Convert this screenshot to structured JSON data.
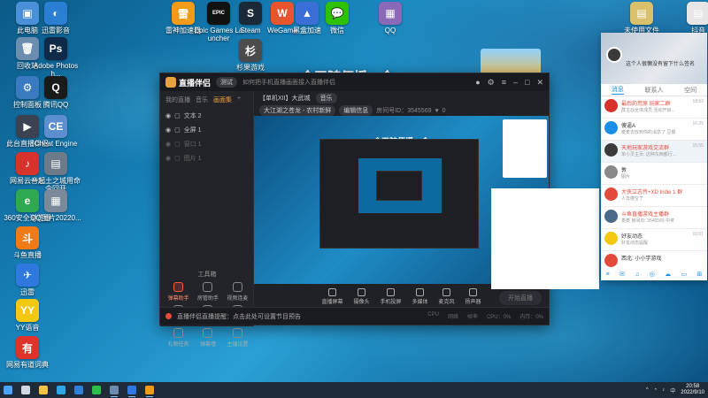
{
  "desktop": {
    "icons": [
      {
        "label": "此电脑",
        "color": "#4a90d9",
        "glyph": "▣"
      },
      {
        "label": "迅雷影音",
        "color": "#2a7fd4",
        "glyph": "◐"
      },
      {
        "label": "回收站",
        "color": "#6b8db0",
        "glyph": "🗑"
      },
      {
        "label": "Adobe Photosh...",
        "color": "#0e2a48",
        "glyph": "Ps"
      },
      {
        "label": "控制面板",
        "color": "#3a7ac0",
        "glyph": "⚙"
      },
      {
        "label": "腾讯QQ",
        "color": "#1a1a1a",
        "glyph": "Q"
      },
      {
        "label": "此台直播伴侣",
        "color": "#3b4252",
        "glyph": "▶"
      },
      {
        "label": "Cheat Engine",
        "color": "#5b8fd0",
        "glyph": "CE"
      },
      {
        "label": "网易云音乐",
        "color": "#d8322c",
        "glyph": "♪"
      },
      {
        "label": "一起土之城用命令回开",
        "color": "#6c7a8a",
        "glyph": "▤"
      },
      {
        "label": "360安全浏览器",
        "color": "#2fa84f",
        "glyph": "e"
      },
      {
        "label": "QQ图片20220...",
        "color": "#7a8a9a",
        "glyph": "▦"
      },
      {
        "label": "斗鱼直播",
        "color": "#f07b16",
        "glyph": "斗"
      },
      {
        "label": "迅雷",
        "color": "#2e78e0",
        "glyph": "✈"
      },
      {
        "label": "YY语音",
        "color": "#f2c811",
        "glyph": "YY"
      },
      {
        "label": "网易有道词典",
        "color": "#e0322a",
        "glyph": "有"
      },
      {
        "label": "雷神加速器",
        "color": "#f29b1a",
        "glyph": "雷"
      },
      {
        "label": "Epic Games Launcher",
        "color": "#111111",
        "glyph": "EPIC"
      },
      {
        "label": "Steam",
        "color": "#1b2838",
        "glyph": "S"
      },
      {
        "label": "WeGame",
        "color": "#e8542e",
        "glyph": "W"
      },
      {
        "label": "黑盒加速",
        "color": "#3a6fd8",
        "glyph": "▲"
      },
      {
        "label": "微信",
        "color": "#2dc100",
        "glyph": "💬"
      },
      {
        "label": "杉果游戏",
        "color": "#4c4c4c",
        "glyph": "杉"
      },
      {
        "label": "QQ",
        "color": "#8a6ab8",
        "glyph": "▦"
      },
      {
        "label": "未使用文件",
        "color": "#d8c16a",
        "glyph": "▤"
      },
      {
        "label": "抖音",
        "color": "#e6e6e6",
        "glyph": "▤"
      }
    ]
  },
  "banner": {
    "text": "今天随便播一会"
  },
  "app": {
    "logo": "直播伴侣",
    "version_chip": "测试",
    "notice": "如何把手机直播画面接入直播伴侣",
    "left_tabs": [
      "我的直播",
      "音乐",
      "画面集"
    ],
    "scenes": [
      {
        "label": "文本 2",
        "dim": false
      },
      {
        "label": "全屏 1",
        "dim": false
      },
      {
        "label": "窗口 1",
        "dim": true
      },
      {
        "label": "图片 1",
        "dim": true
      }
    ],
    "tools_title": "工具箱",
    "tools": [
      {
        "label": "弹幕助手",
        "hot": true
      },
      {
        "label": "房管助手",
        "hot": false
      },
      {
        "label": "视频连麦",
        "hot": false
      },
      {
        "label": "全网打PK",
        "hot": false
      },
      {
        "label": "斗鱼Buff",
        "hot": false
      },
      {
        "label": "投屏器",
        "hot": false
      },
      {
        "label": "礼物任务",
        "hot": false
      },
      {
        "label": "弹幕墙",
        "hot": false
      },
      {
        "label": "主播设置",
        "hot": false
      }
    ],
    "room_tag": "【单机XII】大武城",
    "room_chip": "音乐",
    "category": "大江湖之苍龙 - 农村新鲜",
    "edit_btn": "编辑信息",
    "room_id": "房间号ID：3545569",
    "fans": "0",
    "bottom_buttons": [
      "直播屏幕",
      "摄像头",
      "手机投屏",
      "多媒体",
      "麦克风",
      "扬声器"
    ],
    "start_button": "开始直播",
    "status_hint": "直播伴侣直播提醒：点击此处可设置节目预告",
    "status_right": [
      "CPU",
      "网络",
      "帧率",
      "CPU：0%",
      "内存：0%"
    ]
  },
  "chat": {
    "status_text": "这个人很懒没有留下什么签名",
    "tabs": [
      "消息",
      "联系人",
      "空间"
    ],
    "active_tab": 0,
    "items": [
      {
        "name": "最后的荒原 玩家二群",
        "msg": "群主@全体成员 活动开启...",
        "time": "18:52",
        "name_red": true,
        "color": "#d8322c"
      },
      {
        "name": "傻逼A",
        "msg": "麦麦去收到你的消息了 豆瓣",
        "time": "16:25",
        "name_red": false,
        "color": "#1a8fe8"
      },
      {
        "name": "天地玩家游戏交流群",
        "msg": "单小灵主页: 这种东西都行...",
        "time": "15:55",
        "name_red": true,
        "color": "#3a3a3a"
      },
      {
        "name": "敦",
        "msg": "图片",
        "time": "",
        "name_red": false,
        "color": "#888888"
      },
      {
        "name": "大侠立志传+XD Indie 1 群",
        "msg": "人去楼空了",
        "time": "",
        "name_red": true,
        "color": "#e24a3c"
      },
      {
        "name": "斗鱼直播游戏主播群",
        "msg": "麦麦 房间ID: 3545569 中奖",
        "time": "",
        "name_red": true,
        "color": "#4a6a8a"
      },
      {
        "name": "好友动态",
        "msg": "好友动态提醒",
        "time": "16:01",
        "name_red": false,
        "color": "#f2c811"
      },
      {
        "name": "西北: 小小学游戏",
        "msg": "",
        "time": "",
        "name_red": false,
        "color": "#e24a3c"
      }
    ],
    "footer_icons": [
      "≡",
      "✉",
      "♫",
      "◎",
      "☁",
      "▭",
      "⊞"
    ]
  },
  "taskbar": {
    "time": "20:58",
    "date": "2022/9/10",
    "apps": [
      {
        "name": "start",
        "color": "#4aa3ff"
      },
      {
        "name": "search",
        "color": "#cfd8e3"
      },
      {
        "name": "file-explorer",
        "color": "#f2c14a"
      },
      {
        "name": "edge",
        "color": "#2ea6e8"
      },
      {
        "name": "store",
        "color": "#2f7fd8"
      },
      {
        "name": "xbox",
        "color": "#2dbd4a"
      },
      {
        "name": "steam",
        "color": "#6c8ab0"
      },
      {
        "name": "xunlei",
        "color": "#2e78e0"
      },
      {
        "name": "livestream",
        "color": "#f29b1a"
      }
    ]
  }
}
